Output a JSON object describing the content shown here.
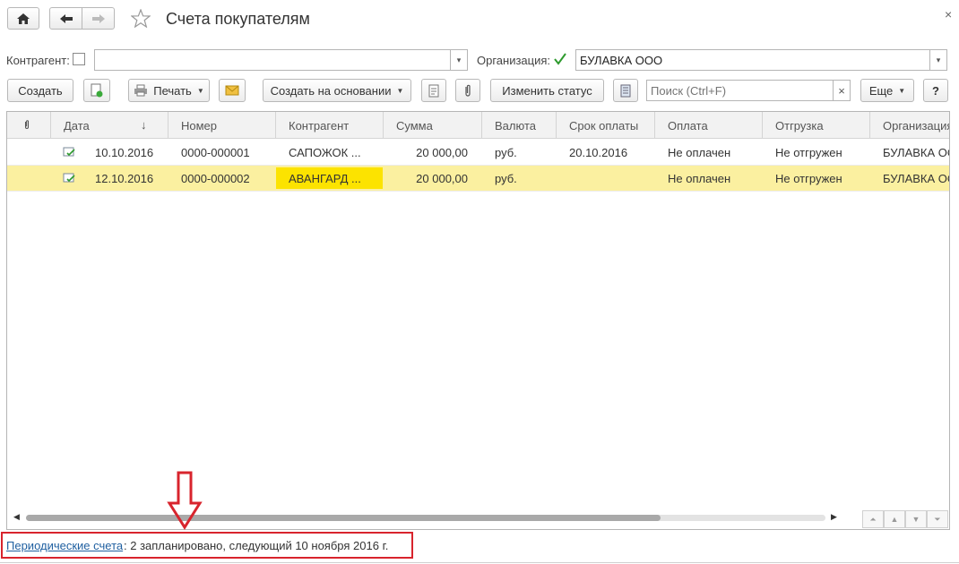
{
  "window": {
    "title": "Счета покупателям",
    "close_glyph": "×"
  },
  "toolbar_nav": {
    "home_icon": "home-icon",
    "back_icon": "arrow-left-icon",
    "forward_icon": "arrow-right-icon",
    "favorite_icon": "star-icon"
  },
  "filters": {
    "counterparty_label": "Контрагент:",
    "counterparty_value": "",
    "counterparty_checked": false,
    "organization_label": "Организация:",
    "organization_value": "БУЛАВКА ООО",
    "organization_checked": true
  },
  "actions": {
    "create": "Создать",
    "print": "Печать",
    "create_based_on": "Создать на основании",
    "change_status": "Изменить статус",
    "search_placeholder": "Поиск (Ctrl+F)",
    "search_clear": "×",
    "more": "Еще",
    "help": "?"
  },
  "table": {
    "attach_header_icon": "paperclip-icon",
    "sort_glyph": "↓",
    "columns": [
      "Дата",
      "Номер",
      "Контрагент",
      "Сумма",
      "Валюта",
      "Срок оплаты",
      "Оплата",
      "Отгрузка",
      "Организация"
    ],
    "rows": [
      {
        "date": "10.10.2016",
        "number": "0000-000001",
        "counterparty": "САПОЖОК ...",
        "amount": "20 000,00",
        "currency": "руб.",
        "due": "20.10.2016",
        "payment": "Не оплачен",
        "shipment": "Не отгружен",
        "org": "БУЛАВКА ООО"
      },
      {
        "date": "12.10.2016",
        "number": "0000-000002",
        "counterparty": "АВАНГАРД ...",
        "amount": "20 000,00",
        "currency": "руб.",
        "due": "",
        "payment": "Не оплачен",
        "shipment": "Не отгружен",
        "org": "БУЛАВКА ООО"
      }
    ],
    "selected_row": 1
  },
  "footer": {
    "link": "Периодические счета",
    "text": ": 2 запланировано, следующий 10 ноября 2016 г."
  },
  "colors": {
    "selection": "#fbf0a0",
    "highlight": "#fce300",
    "annotation": "#d8242d",
    "link": "#1f5fa0"
  }
}
